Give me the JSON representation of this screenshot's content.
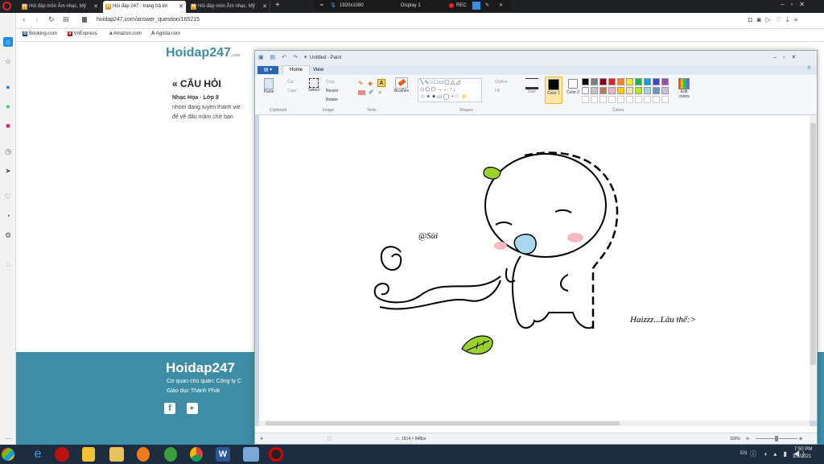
{
  "browser": {
    "tabs": [
      {
        "label": "Hỏi đáp môn Âm nhạc, Mỹ",
        "active": false
      },
      {
        "label": "Hỏi đáp 247 - trang trả lời",
        "active": true
      },
      {
        "label": "Hỏi đáp môn Âm nhạc, Mỹ",
        "active": false
      }
    ],
    "new_tab": "+",
    "recorder": {
      "resolution": "1920x1080",
      "display": "Display 1",
      "rec": "REC"
    },
    "url": "hoidap247.com/answer_question/165215",
    "bookmarks": [
      "Booking.com",
      "VnExpress",
      "Amazon.com",
      "Agoda.com"
    ]
  },
  "page": {
    "logo": "Hoidap247",
    "logo_sub": ".com",
    "section_title": "« CÂU HỎI",
    "subject": "Nhạc Họa · Lớp 8",
    "question_line1": "nhóm đang tuyển thành viê",
    "question_line2": "để vẽ đâu mầm chờ bạn",
    "footer_logo": "Hoidap247",
    "footer_line1": "Cơ quan chủ quản: Công ty C",
    "footer_line2": "Giáo dục Thành Phát"
  },
  "paint": {
    "title": "Untitled - Paint",
    "tabs": [
      "Home",
      "View"
    ],
    "groups": [
      "Clipboard",
      "Image",
      "Tools",
      "Shapes",
      "Colors"
    ],
    "clipboard": {
      "paste": "Paste",
      "cut": "Cut",
      "copy": "Copy"
    },
    "image": {
      "select": "Select",
      "crop": "Crop",
      "resize": "Resize",
      "rotate": "Rotate"
    },
    "brushes": "Brushes",
    "outline": "Outline",
    "fill": "Fill",
    "size": "Size",
    "color1": "Color 1",
    "color2": "Color 2",
    "edit_colors": "Edit colors",
    "palette": [
      "#000000",
      "#7f7f7f",
      "#880015",
      "#ed1c24",
      "#ff7f27",
      "#fff200",
      "#22b14c",
      "#00a2e8",
      "#3f48cc",
      "#a349a4",
      "#ffffff",
      "#c3c3c3",
      "#b97a57",
      "#ffaec9",
      "#ffc90e",
      "#efe4b0",
      "#b5e61d",
      "#99d9ea",
      "#7092be",
      "#c8bfe7"
    ],
    "canvas_text1": "@Sùi",
    "canvas_text2": "Haizzz...Lâu thế:>",
    "dimensions": "1914 × 848px",
    "zoom": "100%"
  },
  "taskbar": {
    "time": "7:50 PM",
    "date": "3/1/2021",
    "lang": "EN"
  }
}
